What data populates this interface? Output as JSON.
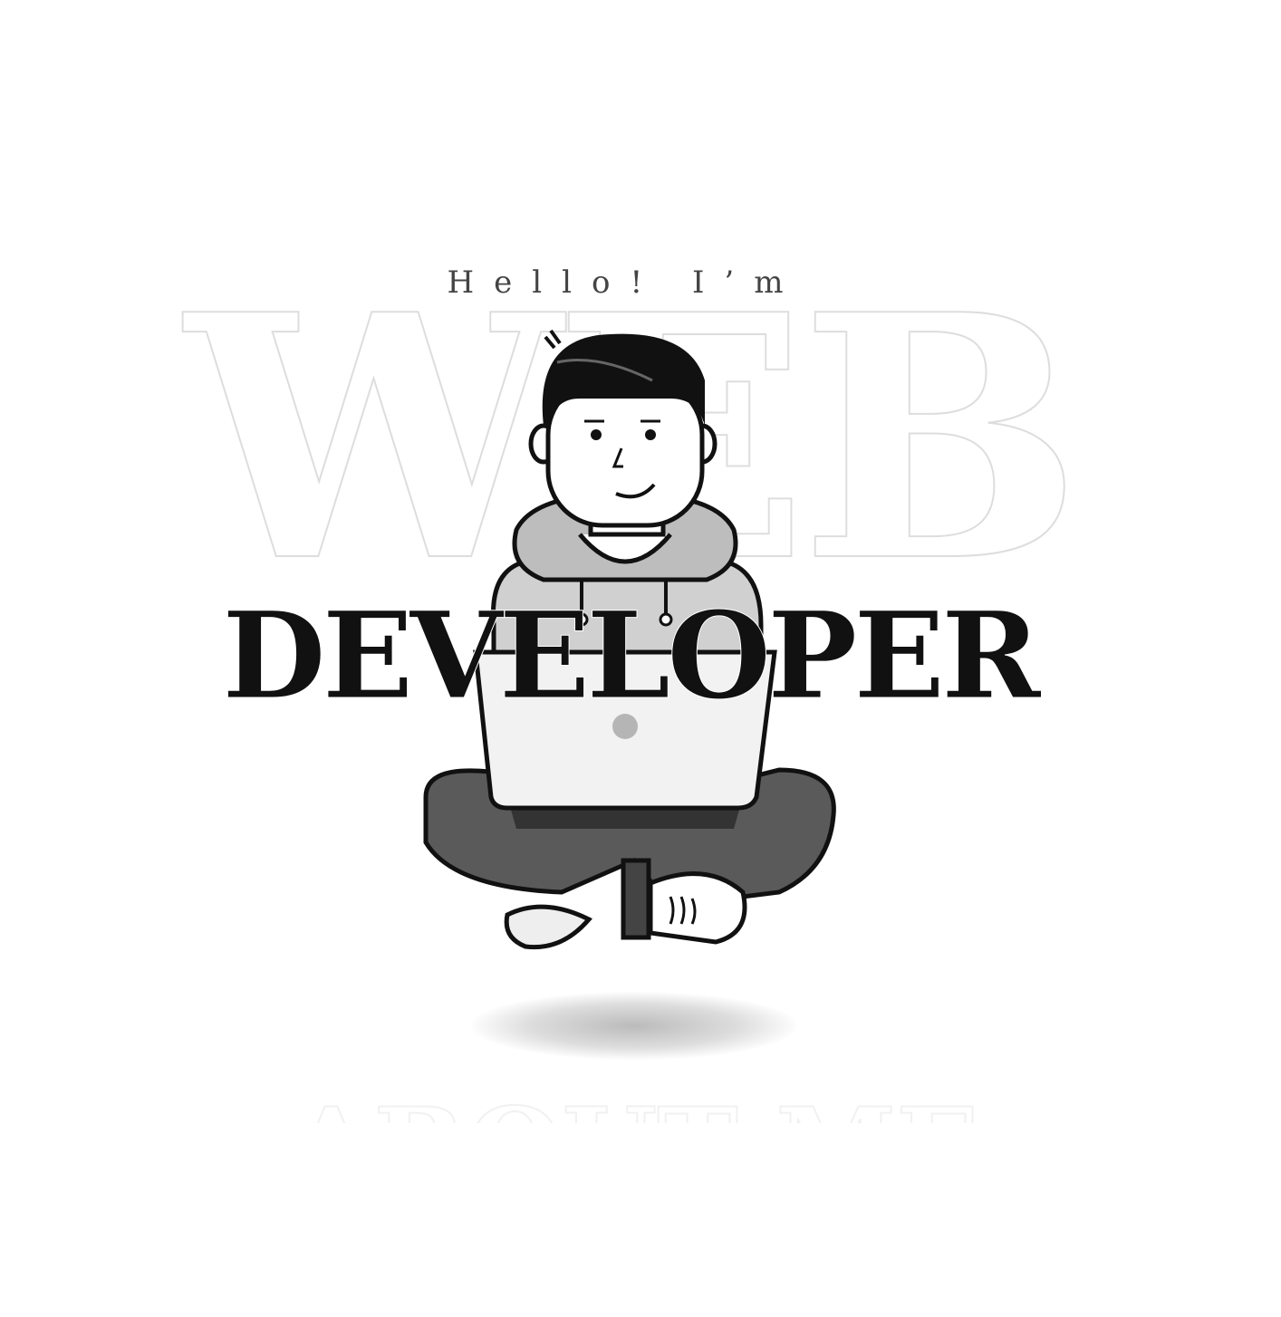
{
  "hero": {
    "greeting": "Hello! I’m",
    "title_outline": "WEB",
    "title_main": "DEVELOPER"
  },
  "next_section": {
    "heading": "ABOUT ME"
  },
  "illustration": {
    "subject": "developer-with-laptop-icon",
    "colors": {
      "hair": "#111111",
      "hoodie": "#cfcfcf",
      "pants": "#555555",
      "laptop": "#f2f2f2"
    }
  }
}
